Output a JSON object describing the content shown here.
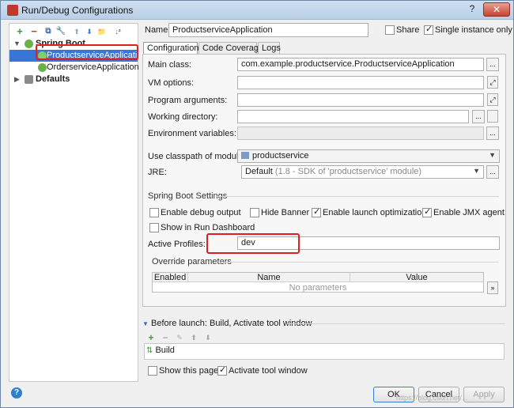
{
  "window": {
    "title": "Run/Debug Configurations",
    "help_glyph": "?",
    "close_glyph": "✕"
  },
  "toolbar_left": {
    "add_glyph": "+",
    "remove_glyph": "−",
    "copy_glyph": "⧉",
    "settings_glyph": "🔧",
    "up_glyph": "⬆",
    "down_glyph": "⬇",
    "folder_glyph": "📁",
    "sort_glyph": "↓²"
  },
  "tree": {
    "spring_boot": "Spring Boot",
    "items": [
      "ProductserviceApplication",
      "OrderserviceApplication"
    ],
    "defaults": "Defaults"
  },
  "header": {
    "name_label": "Name:",
    "name_value": "ProductserviceApplication",
    "share_label": "Share",
    "single_instance_label": "Single instance only"
  },
  "tabs": [
    "Configuration",
    "Code Coverage",
    "Logs"
  ],
  "config": {
    "main_class_label": "Main class:",
    "main_class_value": "com.example.productservice.ProductserviceApplication",
    "vm_options_label": "VM options:",
    "program_args_label": "Program arguments:",
    "working_dir_label": "Working directory:",
    "env_vars_label": "Environment variables:",
    "classpath_label": "Use classpath of module:",
    "classpath_value": "productservice",
    "jre_label": "JRE:",
    "jre_value": "Default",
    "jre_detail": "(1.8 - SDK of 'productservice' module)",
    "ellipsis": "...",
    "expand": "⤢"
  },
  "spring_boot_settings": {
    "title": "Spring Boot Settings",
    "enable_debug": "Enable debug output",
    "hide_banner": "Hide Banner",
    "enable_launch_opt": "Enable launch optimization",
    "enable_jmx": "Enable JMX agent",
    "show_dashboard": "Show in Run Dashboard",
    "active_profiles_label": "Active Profiles:",
    "active_profiles_value": "dev"
  },
  "override": {
    "title": "Override parameters",
    "columns": [
      "Enabled",
      "Name",
      "Value"
    ],
    "empty_text": "No parameters",
    "scroll": "»"
  },
  "before_launch": {
    "title": "Before launch: Build, Activate tool window",
    "item": "Build",
    "show_page": "Show this page",
    "activate_tool": "Activate tool window"
  },
  "buttons": {
    "ok": "OK",
    "cancel": "Cancel",
    "apply": "Apply",
    "help": "?"
  },
  "watermark": "https://blog.csdn.net/..."
}
